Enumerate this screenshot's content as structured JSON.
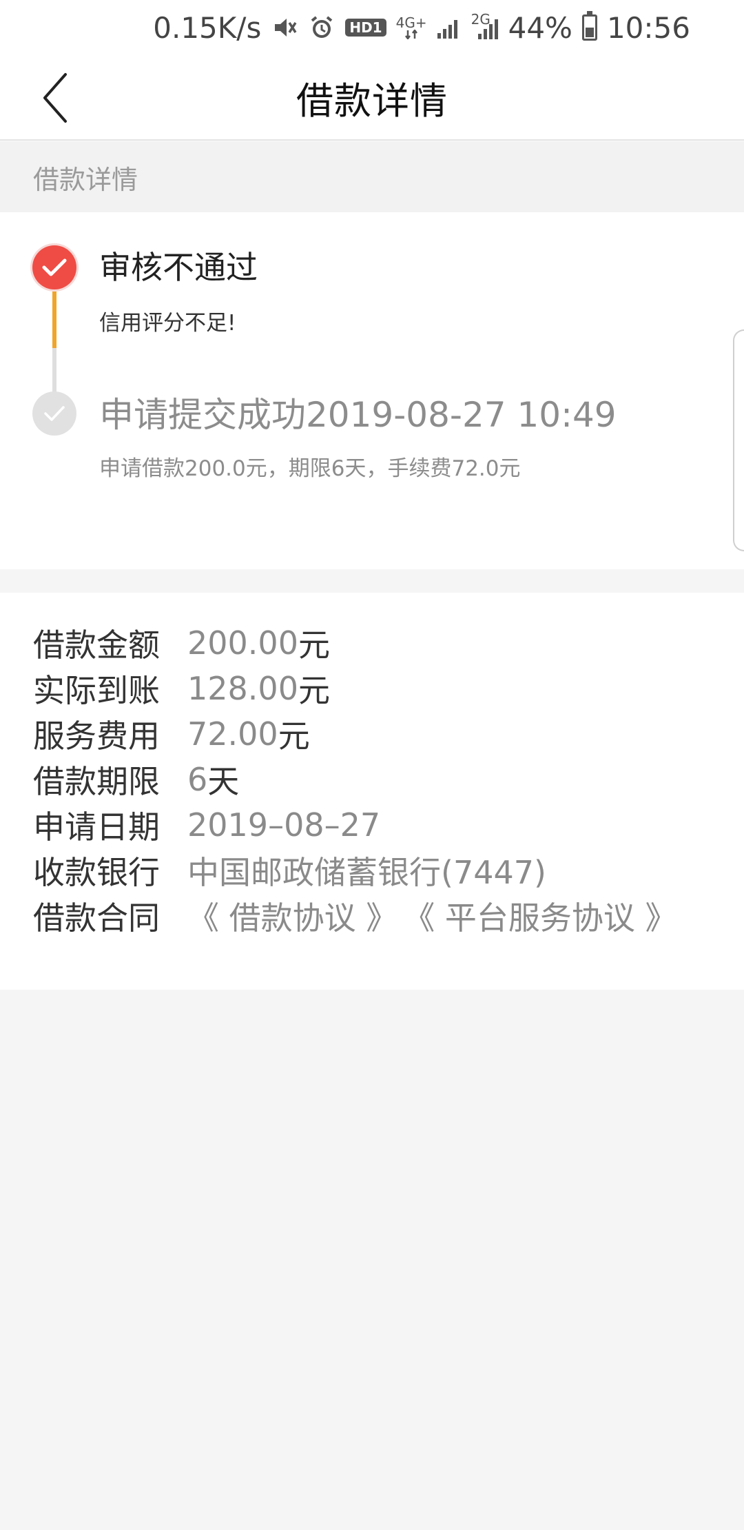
{
  "status_bar": {
    "speed": "0.15K/s",
    "hd_label": "HD1",
    "network_label": "4G+",
    "network2_label": "2G",
    "battery": "44%",
    "battery_level": 0.44,
    "time": "10:56",
    "icons": [
      "mute-icon",
      "alarm-icon",
      "hd-icon",
      "network-4g-icon",
      "signal-icon",
      "signal-2g-icon",
      "battery-icon"
    ]
  },
  "header": {
    "title": "借款详情",
    "back_icon": "chevron-left-icon"
  },
  "section": {
    "label": "借款详情"
  },
  "timeline": {
    "steps": [
      {
        "title": "审核不通过",
        "desc": "信用评分不足!",
        "state": "active",
        "icon": "check-icon",
        "color": "#ef4c45"
      },
      {
        "title": "申请提交成功2019-08-27 10:49",
        "desc": "申请借款200.0元，期限6天，手续费72.0元",
        "state": "done",
        "icon": "check-icon",
        "color": "#e1e1e1"
      }
    ],
    "line_active_color": "#f0a52c"
  },
  "details": {
    "rows": [
      {
        "label": "借款金额",
        "value": "200.00",
        "unit": "元"
      },
      {
        "label": "实际到账",
        "value": "128.00",
        "unit": "元"
      },
      {
        "label": "服务费用",
        "value": "72.00",
        "unit": "元"
      },
      {
        "label": "借款期限",
        "value": "6",
        "unit": "天"
      },
      {
        "label": "申请日期",
        "value": "2019–08–27",
        "unit": ""
      },
      {
        "label": "收款银行",
        "value": "中国邮政储蓄银行(7447)",
        "unit": ""
      }
    ],
    "contract": {
      "label": "借款合同",
      "links": [
        "《 借款协议 》",
        "《 平台服务协议 》"
      ]
    }
  }
}
